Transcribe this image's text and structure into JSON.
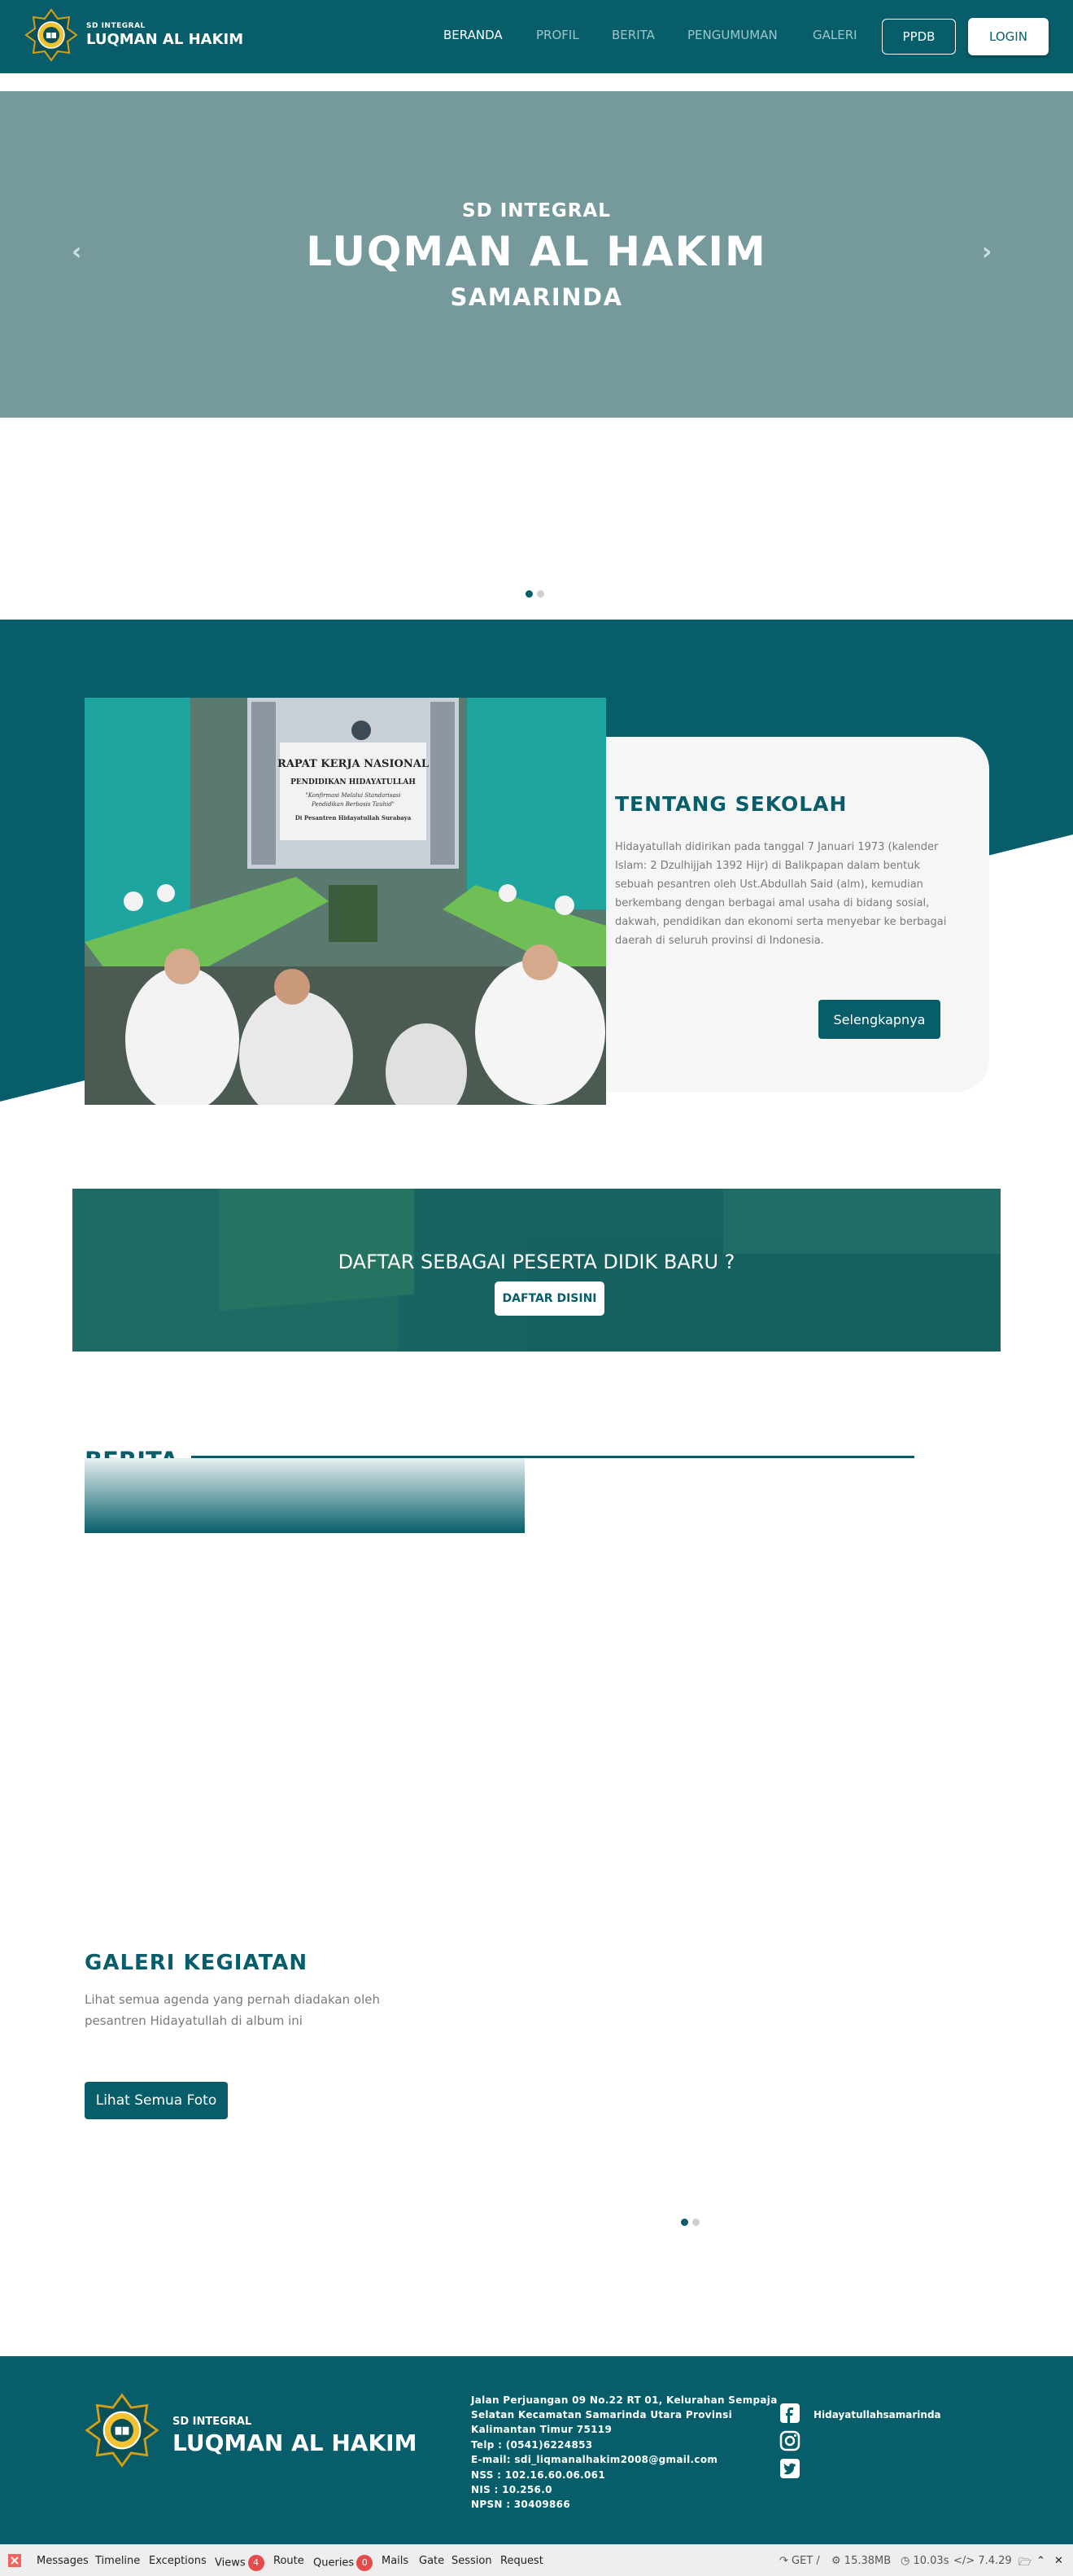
{
  "navbar": {
    "brand_small": "SD INTEGRAL",
    "brand_big": "LUQMAN AL HAKIM",
    "links": [
      "BERANDA",
      "PROFIL",
      "BERITA",
      "PENGUMUMAN",
      "GALERI"
    ],
    "ppdb_label": "PPDB",
    "login_label": "LOGIN"
  },
  "hero": {
    "subtitle": "SD INTEGRAL",
    "title": "LUQMAN AL HAKIM",
    "city": "SAMARINDA",
    "prev_icon": "chevron-left-icon",
    "next_icon": "chevron-right-icon",
    "slide_count": 2,
    "active_slide": 1
  },
  "about": {
    "title": "TENTANG SEKOLAH",
    "text": "Hidayatullah didirikan pada tanggal 7 Januari 1973 (kalender Islam: 2 Dzulhijjah 1392 Hijr) di Balikpapan dalam bentuk sebuah pesantren oleh Ust.Abdullah Said (alm), kemudian berkembang dengan berbagai amal usaha di bidang sosial, dakwah, pendidikan dan ekonomi serta menyebar ke berbagai daerah di seluruh provinsi di Indonesia.",
    "button_label": "Selengkapnya",
    "photo_banner": {
      "line1": "RAPAT KERJA NASIONAL",
      "line2": "PENDIDIKAN HIDAYATULLAH",
      "line3": "\"Konfirmasi Melalui Standarisasi",
      "line4": "Pendidikan Berbasis Tauhid\"",
      "line5": "Di Pesantren Hidayatullah Surabaya"
    }
  },
  "cta": {
    "text": "DAFTAR SEBAGAI PESERTA DIDIK BARU ?",
    "button_label": "DAFTAR DISINI"
  },
  "berita": {
    "title": "BERITA"
  },
  "galeri": {
    "title": "GALERI KEGIATAN",
    "text": "Lihat semua agenda yang pernah diadakan oleh pesantren Hidayatullah di album ini",
    "button_label": "Lihat Semua Foto",
    "slide_count": 2,
    "active_slide": 1
  },
  "footer": {
    "brand_small": "SD INTEGRAL",
    "brand_big": "LUQMAN AL HAKIM",
    "address_lines": [
      "Jalan Perjuangan 09 No.22 RT 01, Kelurahan Sempaja",
      "Selatan Kecamatan Samarinda Utara Provinsi",
      "Kalimantan Timur 75119",
      "Telp : (0541)6224853",
      "E-mail: sdi_liqmanalhakim2008@gmail.com",
      "NSS : 102.16.60.06.061",
      "NIS : 10.256.0",
      "NPSN : 30409866"
    ],
    "social_handle": "Hidayatullahsamarinda",
    "social_icons": [
      "facebook-icon",
      "instagram-icon",
      "twitter-icon"
    ]
  },
  "debugbar": {
    "items": [
      "Messages",
      "Timeline",
      "Exceptions",
      "Views",
      "Route",
      "Queries",
      "Mails",
      "Gate",
      "Session",
      "Request"
    ],
    "views_count": "4",
    "queries_count": "0",
    "method": "GET /",
    "memory": "15.38MB",
    "time": "10.03s",
    "php_version": "7.4.29"
  },
  "colors": {
    "primary": "#075e6a",
    "hero_bg": "#769a9c",
    "card_bg": "#f6f6f6",
    "debug_badge": "#e44c4c"
  }
}
